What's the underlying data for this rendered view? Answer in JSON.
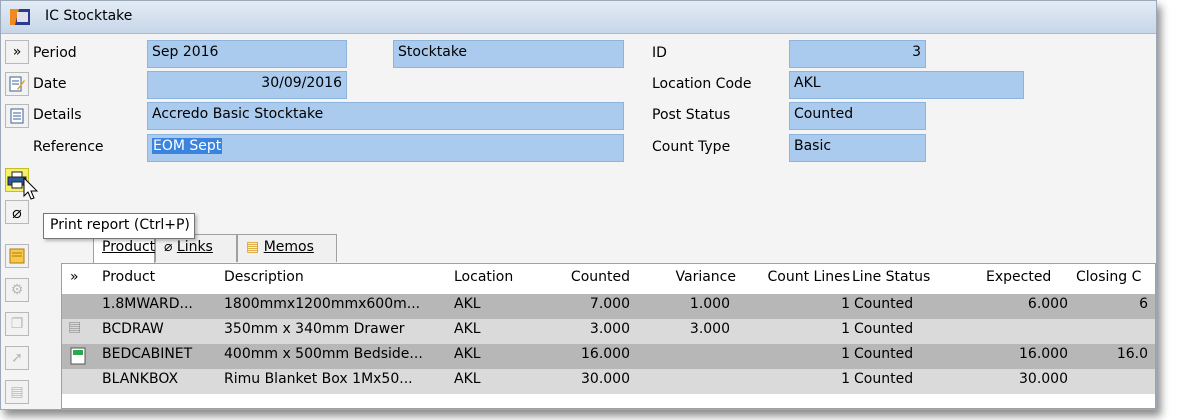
{
  "window": {
    "title": "IC Stocktake"
  },
  "form": {
    "period_label": "Period",
    "period_value": "Sep 2016",
    "stocktake_text": "Stocktake",
    "date_label": "Date",
    "date_value": "30/09/2016",
    "details_label": "Details",
    "details_value": "Accredo Basic Stocktake",
    "reference_label": "Reference",
    "reference_value": "EOM Sept",
    "id_label": "ID",
    "id_value": "3",
    "location_code_label": "Location Code",
    "location_code_value": "AKL",
    "post_status_label": "Post Status",
    "post_status_value": "Counted",
    "count_type_label": "Count Type",
    "count_type_value": "Basic"
  },
  "tooltip": "Print report (Ctrl+P)",
  "tabs": [
    {
      "label": "Products"
    },
    {
      "label": "Links"
    },
    {
      "label": "Memos"
    }
  ],
  "grid": {
    "expand_glyph": "»",
    "headers": [
      "Product",
      "Description",
      "Location",
      "Counted",
      "Variance",
      "Count Lines",
      "Line Status",
      "Expected",
      "Closing C"
    ],
    "rows": [
      [
        "1.8MWARD...",
        "1800mmx1200mmx600m...",
        "AKL",
        "7.000",
        "1.000",
        "1",
        "Counted",
        "6.000",
        "6"
      ],
      [
        "BCDRAW",
        "350mm x 340mm Drawer",
        "AKL",
        "3.000",
        "3.000",
        "1",
        "Counted",
        "",
        ""
      ],
      [
        "BEDCABINET",
        "400mm x 500mm Bedside...",
        "AKL",
        "16.000",
        "",
        "1",
        "Counted",
        "16.000",
        "16.0"
      ],
      [
        "BLANKBOX",
        "Rimu Blanket Box 1Mx50...",
        "AKL",
        "30.000",
        "",
        "1",
        "Counted",
        "30.000",
        ""
      ]
    ]
  },
  "colors": {
    "field_bg": "#aacbee",
    "selection": "#3a84e0",
    "highlight": "#f4f06a"
  }
}
